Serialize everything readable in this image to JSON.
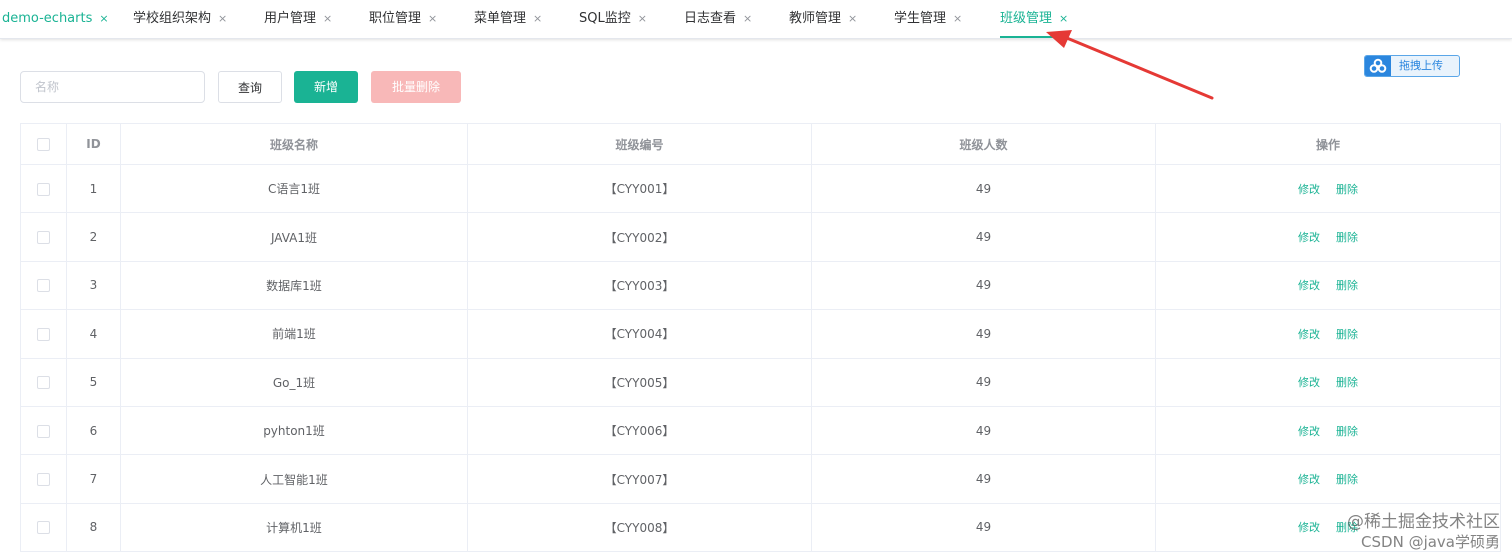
{
  "tabs": [
    {
      "label": "demo-echarts",
      "close": "×"
    },
    {
      "label": "学校组织架构",
      "close": "×"
    },
    {
      "label": "用户管理",
      "close": "×"
    },
    {
      "label": "职位管理",
      "close": "×"
    },
    {
      "label": "菜单管理",
      "close": "×"
    },
    {
      "label": "SQL监控",
      "close": "×"
    },
    {
      "label": "日志查看",
      "close": "×"
    },
    {
      "label": "教师管理",
      "close": "×"
    },
    {
      "label": "学生管理",
      "close": "×"
    },
    {
      "label": "班级管理",
      "close": "×"
    }
  ],
  "active_tab": "班级管理",
  "toolbar": {
    "search_placeholder": "名称",
    "query_label": "查询",
    "add_label": "新增",
    "batch_delete_label": "批量删除"
  },
  "upload": {
    "label": "拖拽上传",
    "icon": "cloud-icon"
  },
  "table": {
    "headers": {
      "id": "ID",
      "name": "班级名称",
      "code": "班级编号",
      "count": "班级人数",
      "ops": "操作"
    },
    "rows": [
      {
        "id": "1",
        "name": "C语言1班",
        "code": "【CYY001】",
        "count": "49",
        "edit": "修改",
        "delete": "删除"
      },
      {
        "id": "2",
        "name": "JAVA1班",
        "code": "【CYY002】",
        "count": "49",
        "edit": "修改",
        "delete": "删除"
      },
      {
        "id": "3",
        "name": "数据库1班",
        "code": "【CYY003】",
        "count": "49",
        "edit": "修改",
        "delete": "删除"
      },
      {
        "id": "4",
        "name": "前端1班",
        "code": "【CYY004】",
        "count": "49",
        "edit": "修改",
        "delete": "删除"
      },
      {
        "id": "5",
        "name": "Go_1班",
        "code": "【CYY005】",
        "count": "49",
        "edit": "修改",
        "delete": "删除"
      },
      {
        "id": "6",
        "name": "pyhton1班",
        "code": "【CYY006】",
        "count": "49",
        "edit": "修改",
        "delete": "删除"
      },
      {
        "id": "7",
        "name": "人工智能1班",
        "code": "【CYY007】",
        "count": "49",
        "edit": "修改",
        "delete": "删除"
      },
      {
        "id": "8",
        "name": "计算机1班",
        "code": "【CYY008】",
        "count": "49",
        "edit": "修改",
        "delete": "删除"
      }
    ]
  },
  "watermark": {
    "line1": "@稀土掘金技术社区",
    "line2": "CSDN @java学硕勇"
  },
  "colors": {
    "accent": "#1ab394",
    "danger_disabled": "#f8b8b8",
    "arrow": "#e53935",
    "upload": "#2b86de"
  }
}
